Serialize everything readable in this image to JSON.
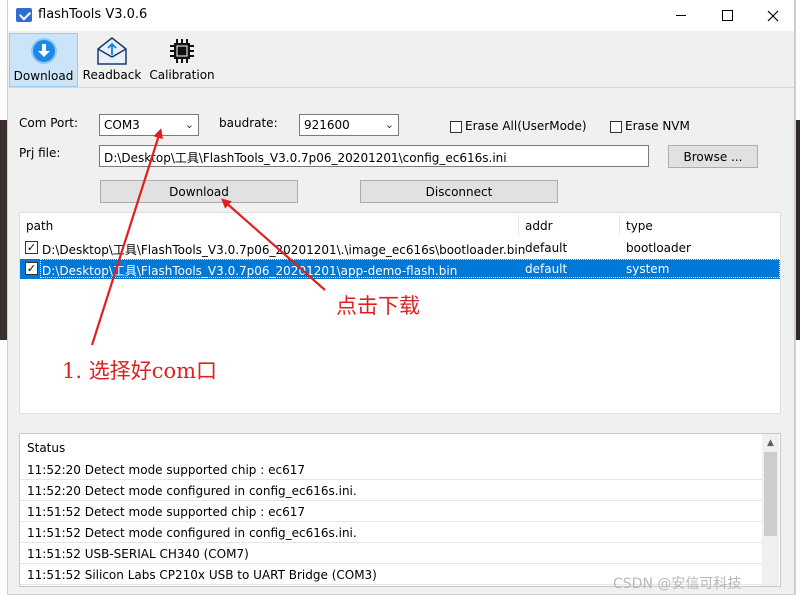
{
  "window": {
    "title": "flashTools V3.0.6"
  },
  "toolbar": {
    "items": [
      {
        "label": "Download",
        "icon": "download-icon",
        "active": true
      },
      {
        "label": "Readback",
        "icon": "readback-icon"
      },
      {
        "label": "Calibration",
        "icon": "chip-icon"
      }
    ]
  },
  "form": {
    "com_port_label": "Com Port:",
    "com_port_value": "COM3",
    "baudrate_label": "baudrate:",
    "baudrate_value": "921600",
    "erase_all_label": "Erase All(UserMode)",
    "erase_nvm_label": "Erase NVM",
    "prj_file_label": "Prj file:",
    "prj_file_value": "D:\\Desktop\\工具\\FlashTools_V3.0.7p06_20201201\\config_ec616s.ini",
    "browse_label": "Browse ...",
    "download_label": "Download",
    "disconnect_label": "Disconnect"
  },
  "file_table": {
    "headers": [
      "path",
      "addr",
      "type"
    ],
    "rows": [
      {
        "checked": true,
        "path": "D:\\Desktop\\工具\\FlashTools_V3.0.7p06_20201201\\.\\image_ec616s\\bootloader.bin",
        "addr": "default",
        "type": "bootloader",
        "selected": false
      },
      {
        "checked": true,
        "path": "D:\\Desktop\\工具\\FlashTools_V3.0.7p06_20201201\\app-demo-flash.bin",
        "addr": "default",
        "type": "system",
        "selected": true
      }
    ]
  },
  "status": {
    "header": "Status",
    "lines": [
      "11:52:20 Detect mode supported chip : ec617",
      "11:52:20 Detect mode configured in  config_ec616s.ini.",
      "11:51:52 Detect mode supported chip : ec617",
      "11:51:52 Detect mode configured in  config_ec616s.ini.",
      "11:51:52 USB-SERIAL CH340 (COM7)",
      "11:51:52 Silicon Labs CP210x USB to UART Bridge (COM3)"
    ]
  },
  "annotations": {
    "click_download": "点击下载",
    "select_com": "1. 选择好com口",
    "color": "#e02020"
  },
  "watermark": "CSDN @安信可科技"
}
